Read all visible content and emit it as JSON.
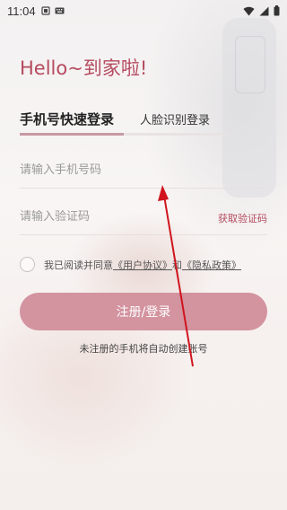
{
  "status_bar": {
    "time": "11:04"
  },
  "greeting": "Hello~到家啦!",
  "tabs": [
    {
      "label": "手机号快速登录",
      "active": true
    },
    {
      "label": "人脸识别登录",
      "active": false
    }
  ],
  "phone_field": {
    "placeholder": "请输入手机号码",
    "value": ""
  },
  "code_field": {
    "placeholder": "请输入验证码",
    "value": ""
  },
  "get_code_label": "获取验证码",
  "agreement": {
    "prefix": "我已阅读并同意",
    "user_agreement": "《用户协议》",
    "and": "和",
    "privacy_policy": "《隐私政策》"
  },
  "submit_label": "注册/登录",
  "hint": "未注册的手机将自动创建账号",
  "colors": {
    "accent": "#b54a5e",
    "button": "#d3939f",
    "annotation_arrow": "#d0141e"
  }
}
